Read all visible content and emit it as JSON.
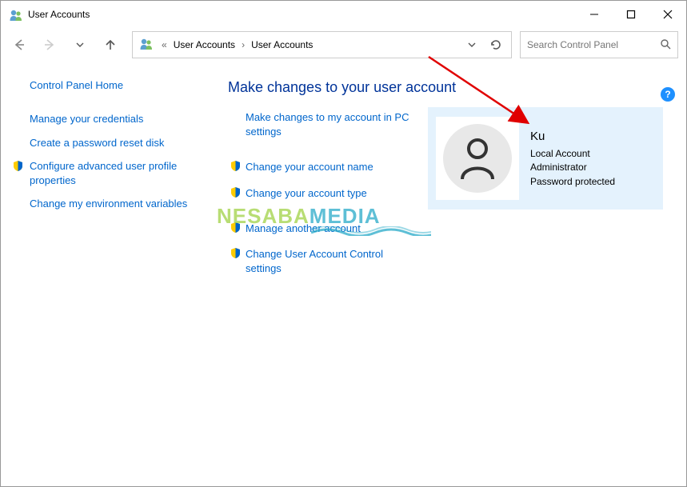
{
  "window": {
    "title": "User Accounts"
  },
  "nav": {
    "breadcrumbs": [
      "User Accounts",
      "User Accounts"
    ],
    "search_placeholder": "Search Control Panel"
  },
  "sidebar": {
    "home": "Control Panel Home",
    "links": [
      {
        "label": "Manage your credentials",
        "shield": false
      },
      {
        "label": "Create a password reset disk",
        "shield": false
      },
      {
        "label": "Configure advanced user profile properties",
        "shield": true
      },
      {
        "label": "Change my environment variables",
        "shield": false
      }
    ]
  },
  "main": {
    "heading": "Make changes to your user account",
    "actions": [
      {
        "label": "Make changes to my account in PC settings",
        "shield": false
      },
      {
        "label": "Change your account name",
        "shield": true
      },
      {
        "label": "Change your account type",
        "shield": true
      },
      {
        "label": "Manage another account",
        "shield": true
      },
      {
        "label": "Change User Account Control settings",
        "shield": true
      }
    ]
  },
  "user": {
    "name": "Ku",
    "type": "Local Account",
    "role": "Administrator",
    "protection": "Password protected"
  },
  "watermark": {
    "part1": "NESABA",
    "part2": "MEDIA"
  },
  "help_glyph": "?"
}
